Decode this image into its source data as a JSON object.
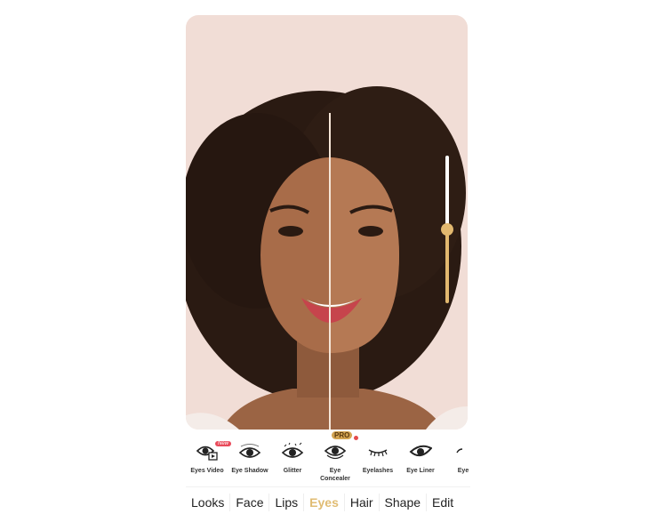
{
  "slider": {
    "value_percent": 50,
    "fill_color": "#e2b86f"
  },
  "tools": [
    {
      "label": "Eyes Video",
      "icon": "eye-video-icon",
      "badge": "New"
    },
    {
      "label": "Eye Shadow",
      "icon": "eye-shadow-icon"
    },
    {
      "label": "Glitter",
      "icon": "eye-glitter-icon"
    },
    {
      "label": "Eye Concealer",
      "icon": "eye-concealer-icon",
      "badge": "PRO"
    },
    {
      "label": "Eyelashes",
      "icon": "eyelashes-icon"
    },
    {
      "label": "Eye Liner",
      "icon": "eye-liner-icon"
    },
    {
      "label": "Eye",
      "icon": "eye-icon"
    }
  ],
  "tabs": [
    {
      "label": "Looks"
    },
    {
      "label": "Face"
    },
    {
      "label": "Lips"
    },
    {
      "label": "Eyes",
      "active": true
    },
    {
      "label": "Hair"
    },
    {
      "label": "Shape"
    },
    {
      "label": "Edit"
    }
  ],
  "colors": {
    "accent": "#e0bc73",
    "background": "#f1ddd6"
  }
}
